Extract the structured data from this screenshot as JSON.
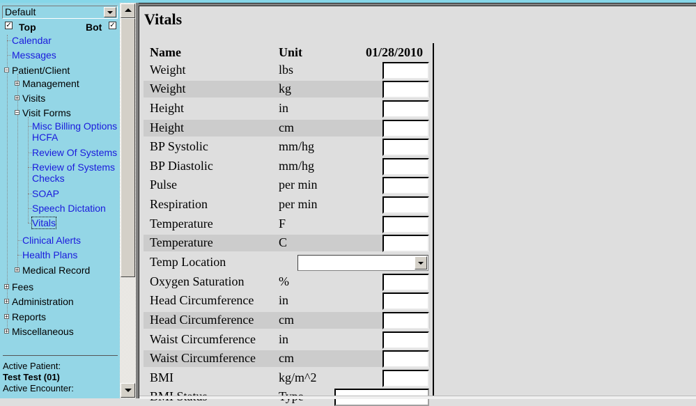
{
  "nav": {
    "view_select": "Default",
    "top_label": "Top",
    "top_checked": true,
    "bot_label": "Bot",
    "bot_checked": true,
    "tree": {
      "calendar": "Calendar",
      "messages": "Messages",
      "patient_client": "Patient/Client",
      "management": "Management",
      "visits": "Visits",
      "visit_forms": "Visit Forms",
      "misc_billing_1": "Misc Billing Options",
      "misc_billing_2": "HCFA",
      "review_of_systems": "Review Of Systems",
      "review_checks_1": "Review of Systems",
      "review_checks_2": "Checks",
      "soap": "SOAP",
      "speech_dictation": "Speech Dictation",
      "vitals": "Vitals",
      "clinical_alerts": "Clinical Alerts",
      "health_plans": "Health Plans",
      "medical_record": "Medical Record",
      "fees": "Fees",
      "administration": "Administration",
      "reports": "Reports",
      "miscellaneous": "Miscellaneous"
    },
    "expander": {
      "plus": "+",
      "minus": "−"
    },
    "active_patient_label": "Active Patient:",
    "active_patient": "Test Test (01)",
    "active_encounter_label": "Active Encounter:"
  },
  "main": {
    "title": "Vitals",
    "headers": {
      "name": "Name",
      "unit": "Unit",
      "date": "01/28/2010"
    },
    "rows": [
      {
        "name": "Weight",
        "unit": "lbs",
        "value": ""
      },
      {
        "name": "Weight",
        "unit": "kg",
        "value": ""
      },
      {
        "name": "Height",
        "unit": "in",
        "value": ""
      },
      {
        "name": "Height",
        "unit": "cm",
        "value": ""
      },
      {
        "name": "BP Systolic",
        "unit": "mm/hg",
        "value": ""
      },
      {
        "name": "BP Diastolic",
        "unit": "mm/hg",
        "value": ""
      },
      {
        "name": "Pulse",
        "unit": "per min",
        "value": ""
      },
      {
        "name": "Respiration",
        "unit": "per min",
        "value": ""
      },
      {
        "name": "Temperature",
        "unit": "F",
        "value": ""
      },
      {
        "name": "Temperature",
        "unit": "C",
        "value": ""
      },
      {
        "name": "Temp Location",
        "unit": "",
        "selected": ""
      },
      {
        "name": "Oxygen Saturation",
        "unit": "%",
        "value": ""
      },
      {
        "name": "Head Circumference",
        "unit": "in",
        "value": ""
      },
      {
        "name": "Head Circumference",
        "unit": "cm",
        "value": ""
      },
      {
        "name": "Waist Circumference",
        "unit": "in",
        "value": ""
      },
      {
        "name": "Waist Circumference",
        "unit": "cm",
        "value": ""
      },
      {
        "name": "BMI",
        "unit": "kg/m^2",
        "value": ""
      },
      {
        "name": "BMI Status",
        "unit": "Type",
        "value": ""
      }
    ]
  }
}
